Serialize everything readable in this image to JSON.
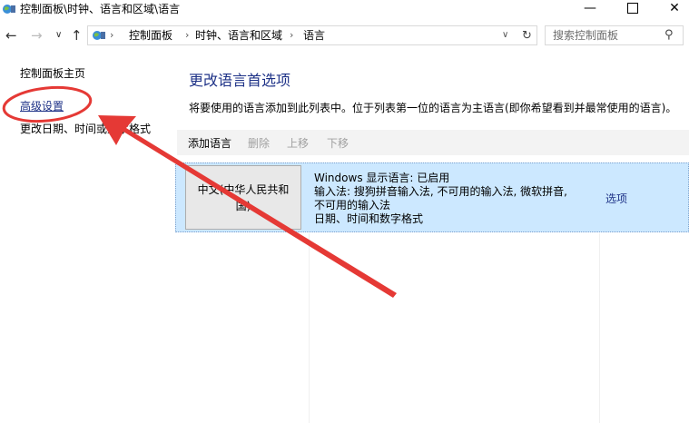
{
  "window": {
    "title": "控制面板\\时钟、语言和区域\\语言",
    "minimize_icon": "minimize-icon",
    "maximize_icon": "maximize-icon",
    "close_icon": "close-icon"
  },
  "address_bar": {
    "crumbs": [
      "控制面板",
      "时钟、语言和区域",
      "语言"
    ],
    "search_placeholder": "搜索控制面板"
  },
  "sidebar": {
    "items": [
      {
        "label": "控制面板主页"
      },
      {
        "label": "高级设置"
      },
      {
        "label": "更改日期、时间或数字格式"
      }
    ]
  },
  "main": {
    "title": "更改语言首选项",
    "description": "将要使用的语言添加到此列表中。位于列表第一位的语言为主语言(即你希望看到并最常使用的语言)。",
    "toolbar": {
      "add": "添加语言",
      "remove": "删除",
      "move_up": "上移",
      "move_down": "下移"
    },
    "languages": [
      {
        "name": "中文(中华人民共和国)",
        "info": [
          "Windows 显示语言: 已启用",
          "输入法: 搜狗拼音输入法, 不可用的输入法, 微软拼音,",
          "不可用的输入法",
          "日期、时间和数字格式"
        ],
        "options": "选项"
      }
    ]
  },
  "colors": {
    "link": "#1e3287",
    "selected_row": "#cce8ff",
    "annotation": "#e53935"
  }
}
